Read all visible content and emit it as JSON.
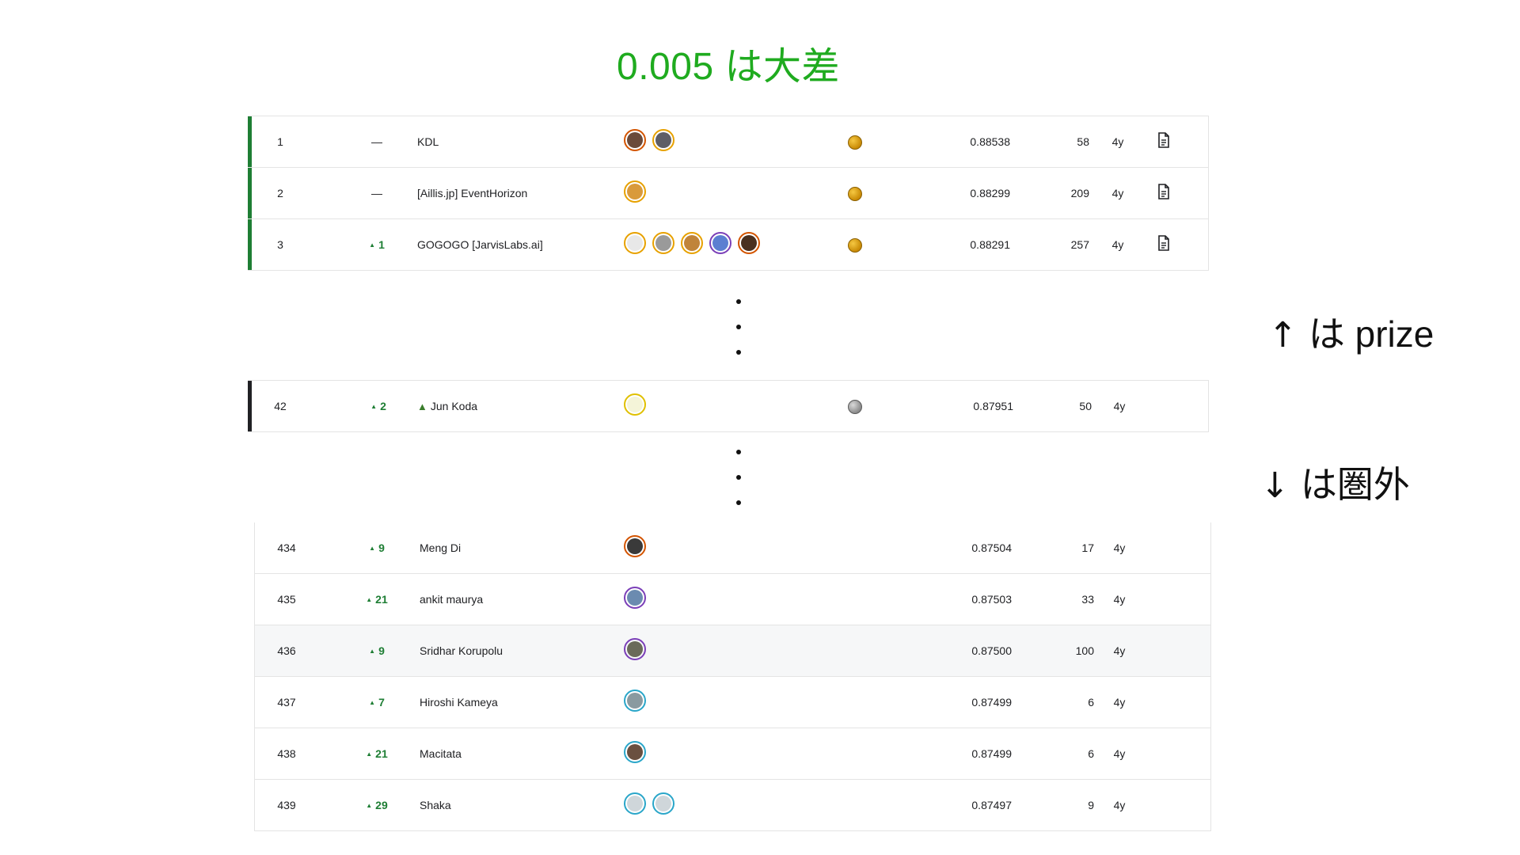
{
  "title": "0.005 は大差",
  "notes": {
    "prize": {
      "arrow": "↑",
      "text": "は prize"
    },
    "out": {
      "arrow": "↓",
      "text": "は圏外"
    }
  },
  "colors": {
    "title": "#1fab1f",
    "delta_up": "#1e7e34",
    "gold_bar": "#1e7e34",
    "silver_bar": "#202124"
  },
  "top_rows": [
    {
      "rank": "1",
      "delta": "—",
      "up": false,
      "team": "KDL",
      "avatars": 2,
      "medal": "gold",
      "score": "0.88538",
      "entries": "58",
      "last": "4y",
      "writeup": true
    },
    {
      "rank": "2",
      "delta": "—",
      "up": false,
      "team": "[Aillis.jp] EventHorizon",
      "avatars": 1,
      "medal": "gold",
      "score": "0.88299",
      "entries": "209",
      "last": "4y",
      "writeup": true
    },
    {
      "rank": "3",
      "delta": "1",
      "up": true,
      "team": "GOGOGO [JarvisLabs.ai]",
      "avatars": 5,
      "medal": "gold",
      "score": "0.88291",
      "entries": "257",
      "last": "4y",
      "writeup": true
    }
  ],
  "mid_row": {
    "rank": "42",
    "delta": "2",
    "up": true,
    "team_icon": "turtle-icon",
    "team": "Jun Koda",
    "avatars": 1,
    "medal": "silver",
    "score": "0.87951",
    "entries": "50",
    "last": "4y"
  },
  "bottom_rows": [
    {
      "rank": "434",
      "delta": "9",
      "team": "Meng Di",
      "avatars": 1,
      "score": "0.87504",
      "entries": "17",
      "last": "4y"
    },
    {
      "rank": "435",
      "delta": "21",
      "team": "ankit maurya",
      "avatars": 1,
      "score": "0.87503",
      "entries": "33",
      "last": "4y"
    },
    {
      "rank": "436",
      "delta": "9",
      "team": "Sridhar Korupolu",
      "avatars": 1,
      "score": "0.87500",
      "entries": "100",
      "last": "4y"
    },
    {
      "rank": "437",
      "delta": "7",
      "team": "Hiroshi Kameya",
      "avatars": 1,
      "score": "0.87499",
      "entries": "6",
      "last": "4y"
    },
    {
      "rank": "438",
      "delta": "21",
      "team": "Macitata",
      "avatars": 1,
      "score": "0.87499",
      "entries": "6",
      "last": "4y"
    },
    {
      "rank": "439",
      "delta": "29",
      "team": "Shaka",
      "avatars": 2,
      "score": "0.87497",
      "entries": "9",
      "last": "4y"
    }
  ]
}
